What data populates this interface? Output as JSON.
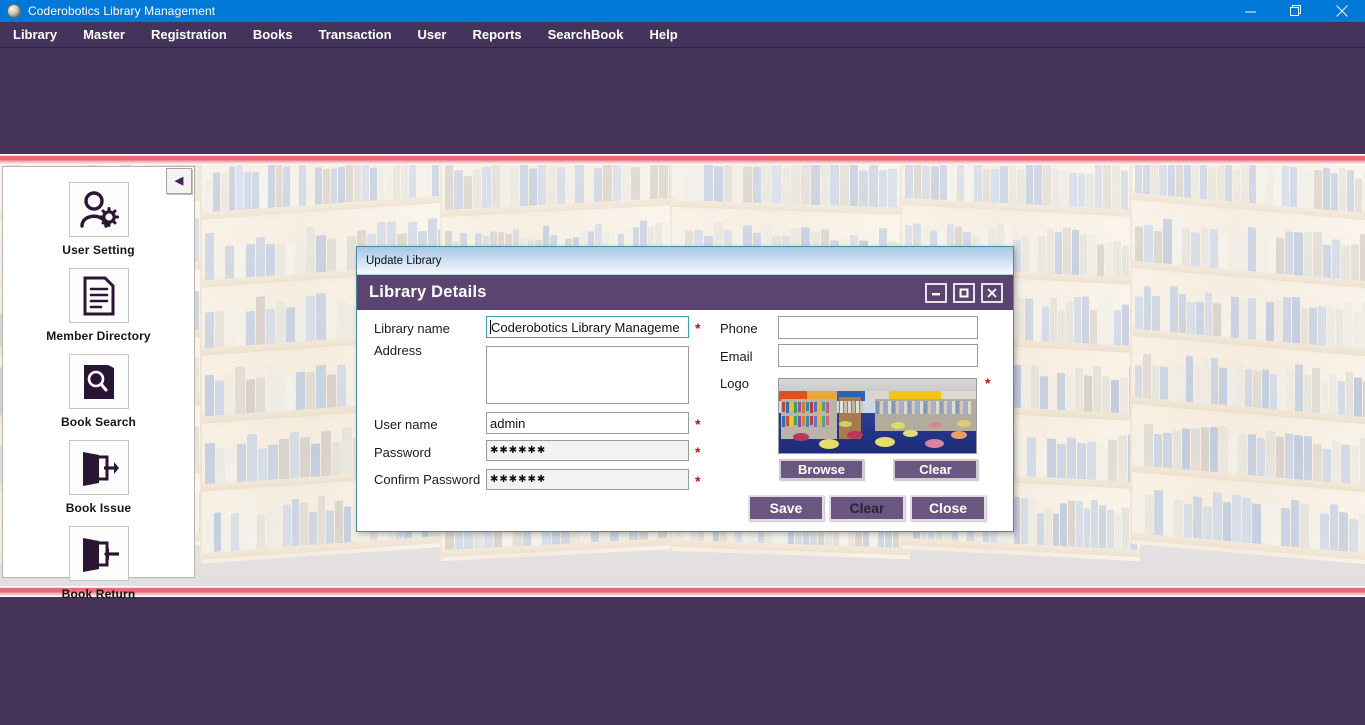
{
  "window": {
    "title": "Coderobotics Library Management",
    "app_icon": "app-icon",
    "controls": [
      {
        "name": "minimize",
        "glyph": "minimize-icon"
      },
      {
        "name": "restore",
        "glyph": "restore-icon"
      },
      {
        "name": "close",
        "glyph": "close-icon"
      }
    ]
  },
  "menubar": {
    "items": [
      {
        "label": "Library"
      },
      {
        "label": "Master"
      },
      {
        "label": "Registration"
      },
      {
        "label": "Books"
      },
      {
        "label": "Transaction"
      },
      {
        "label": "User"
      },
      {
        "label": "Reports"
      },
      {
        "label": "SearchBook"
      },
      {
        "label": "Help"
      }
    ]
  },
  "sidebar": {
    "collapse_glyph": "◀",
    "items": [
      {
        "label": "User Setting",
        "icon": "user-setting-icon"
      },
      {
        "label": "Member Directory",
        "icon": "member-directory-icon"
      },
      {
        "label": "Book Search",
        "icon": "book-search-icon"
      },
      {
        "label": "Book Issue",
        "icon": "book-issue-icon"
      },
      {
        "label": "Book Return",
        "icon": "book-return-icon"
      }
    ]
  },
  "dialog": {
    "window_title": "Update Library",
    "header_title": "Library Details",
    "controls": [
      {
        "name": "minimize",
        "glyph": "minimize-icon"
      },
      {
        "name": "maximize",
        "glyph": "maximize-icon"
      },
      {
        "name": "close",
        "glyph": "close-icon"
      }
    ],
    "fields": {
      "library_name_label": "Library name",
      "library_name_value": "Coderobotics Library Manageme",
      "address_label": "Address",
      "address_value": "",
      "user_name_label": "User name",
      "user_name_value": "admin",
      "password_label": "Password",
      "password_value": "✱✱✱✱✱✱",
      "confirm_password_label": "Confirm Password",
      "confirm_password_value": "✱✱✱✱✱✱",
      "phone_label": "Phone",
      "phone_value": "",
      "email_label": "Email",
      "email_value": "",
      "logo_label": "Logo"
    },
    "required_marker": "*",
    "buttons": {
      "browse": "Browse",
      "logo_clear": "Clear",
      "save": "Save",
      "clear": "Clear",
      "close": "Close"
    }
  },
  "colors": {
    "os_titlebar": "#0078d7",
    "menubar": "#44345c",
    "banner": "#453458",
    "separator": "#e5697d",
    "dialog_header": "#5c4470",
    "button": "#6b5681",
    "required": "#cc1111",
    "focus_border": "#3aa0b4"
  }
}
